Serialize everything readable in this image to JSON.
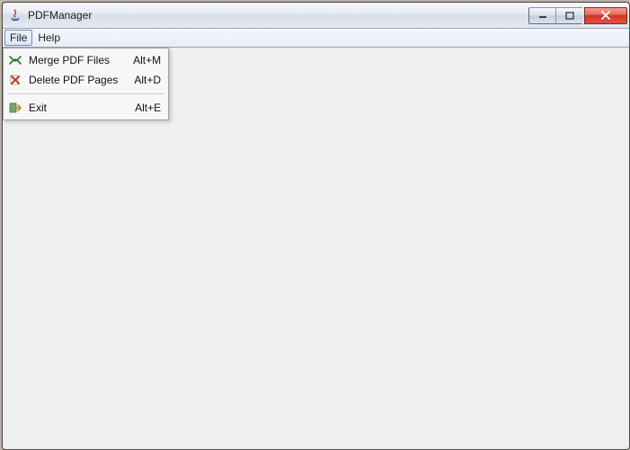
{
  "window": {
    "title": "PDFManager"
  },
  "menubar": {
    "items": [
      {
        "label": "File",
        "active": true
      },
      {
        "label": "Help",
        "active": false
      }
    ]
  },
  "file_menu": {
    "items": [
      {
        "icon": "merge-icon",
        "label": "Merge PDF Files",
        "accel": "Alt+M"
      },
      {
        "icon": "delete-icon",
        "label": "Delete PDF Pages",
        "accel": "Alt+D"
      }
    ],
    "exit": {
      "icon": "exit-icon",
      "label": "Exit",
      "accel": "Alt+E"
    }
  }
}
